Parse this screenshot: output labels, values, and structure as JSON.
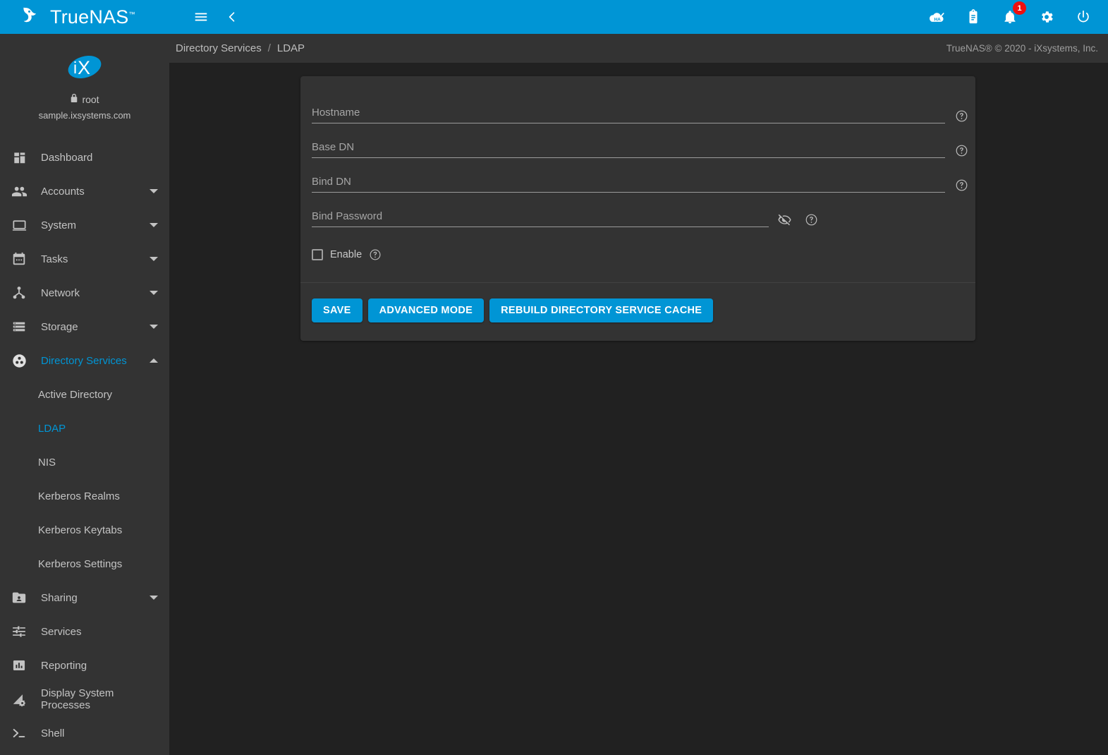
{
  "app": {
    "brand": "TrueNAS",
    "trademark": "™"
  },
  "topbar": {
    "menu_icon": "hamburger-menu-icon",
    "back_icon": "chevron-left-icon",
    "ha_icon": "ha-status-icon",
    "tasks_icon": "clipboard-icon",
    "notifications_icon": "bell-icon",
    "notifications_count": "1",
    "settings_icon": "gear-icon",
    "power_icon": "power-icon",
    "accent_color": "#0095d5"
  },
  "sidebar": {
    "avatar_icon": "ix-logo",
    "lock_icon": "lock-icon",
    "username": "root",
    "hostname": "sample.ixsystems.com",
    "items": [
      {
        "label": "Dashboard",
        "icon": "dashboard-icon",
        "expandable": false,
        "active": false
      },
      {
        "label": "Accounts",
        "icon": "accounts-icon",
        "expandable": true,
        "expanded": false,
        "active": false
      },
      {
        "label": "System",
        "icon": "system-icon",
        "expandable": true,
        "expanded": false,
        "active": false
      },
      {
        "label": "Tasks",
        "icon": "tasks-calendar-icon",
        "expandable": true,
        "expanded": false,
        "active": false
      },
      {
        "label": "Network",
        "icon": "network-icon",
        "expandable": true,
        "expanded": false,
        "active": false
      },
      {
        "label": "Storage",
        "icon": "storage-icon",
        "expandable": true,
        "expanded": false,
        "active": false
      },
      {
        "label": "Directory Services",
        "icon": "directory-services-icon",
        "expandable": true,
        "expanded": true,
        "active": true
      }
    ],
    "directory_services_children": [
      {
        "label": "Active Directory",
        "active": false
      },
      {
        "label": "LDAP",
        "active": true
      },
      {
        "label": "NIS",
        "active": false
      },
      {
        "label": "Kerberos Realms",
        "active": false
      },
      {
        "label": "Kerberos Keytabs",
        "active": false
      },
      {
        "label": "Kerberos Settings",
        "active": false
      }
    ],
    "items_after": [
      {
        "label": "Sharing",
        "icon": "sharing-folder-icon",
        "expandable": true,
        "expanded": false,
        "active": false
      },
      {
        "label": "Services",
        "icon": "services-sliders-icon",
        "expandable": false,
        "active": false
      },
      {
        "label": "Reporting",
        "icon": "reporting-chart-icon",
        "expandable": false,
        "active": false
      },
      {
        "label": "Display System Processes",
        "icon": "system-processes-icon",
        "expandable": false,
        "active": false
      },
      {
        "label": "Shell",
        "icon": "shell-terminal-icon",
        "expandable": false,
        "active": false
      }
    ],
    "active_color": "#0095d5"
  },
  "breadcrumb": {
    "root": "Directory Services",
    "separator": "/",
    "current": "LDAP"
  },
  "copyright": "TrueNAS® © 2020 - iXsystems, Inc.",
  "form": {
    "fields": [
      {
        "label": "Hostname",
        "value": "",
        "placeholder": "",
        "help_icon": "help-circle-icon"
      },
      {
        "label": "Base DN",
        "value": "",
        "placeholder": "",
        "help_icon": "help-circle-icon"
      },
      {
        "label": "Bind DN",
        "value": "",
        "placeholder": "",
        "help_icon": "help-circle-icon"
      },
      {
        "label": "Bind Password",
        "value": "",
        "placeholder": "",
        "help_icon": "help-circle-icon",
        "toggle_icon": "eye-off-icon"
      }
    ],
    "checkbox": {
      "label": "Enable",
      "checked": false,
      "help_icon": "help-circle-icon"
    }
  },
  "actions": {
    "save": "SAVE",
    "advanced_mode": "ADVANCED MODE",
    "rebuild_cache": "REBUILD DIRECTORY SERVICE CACHE"
  }
}
